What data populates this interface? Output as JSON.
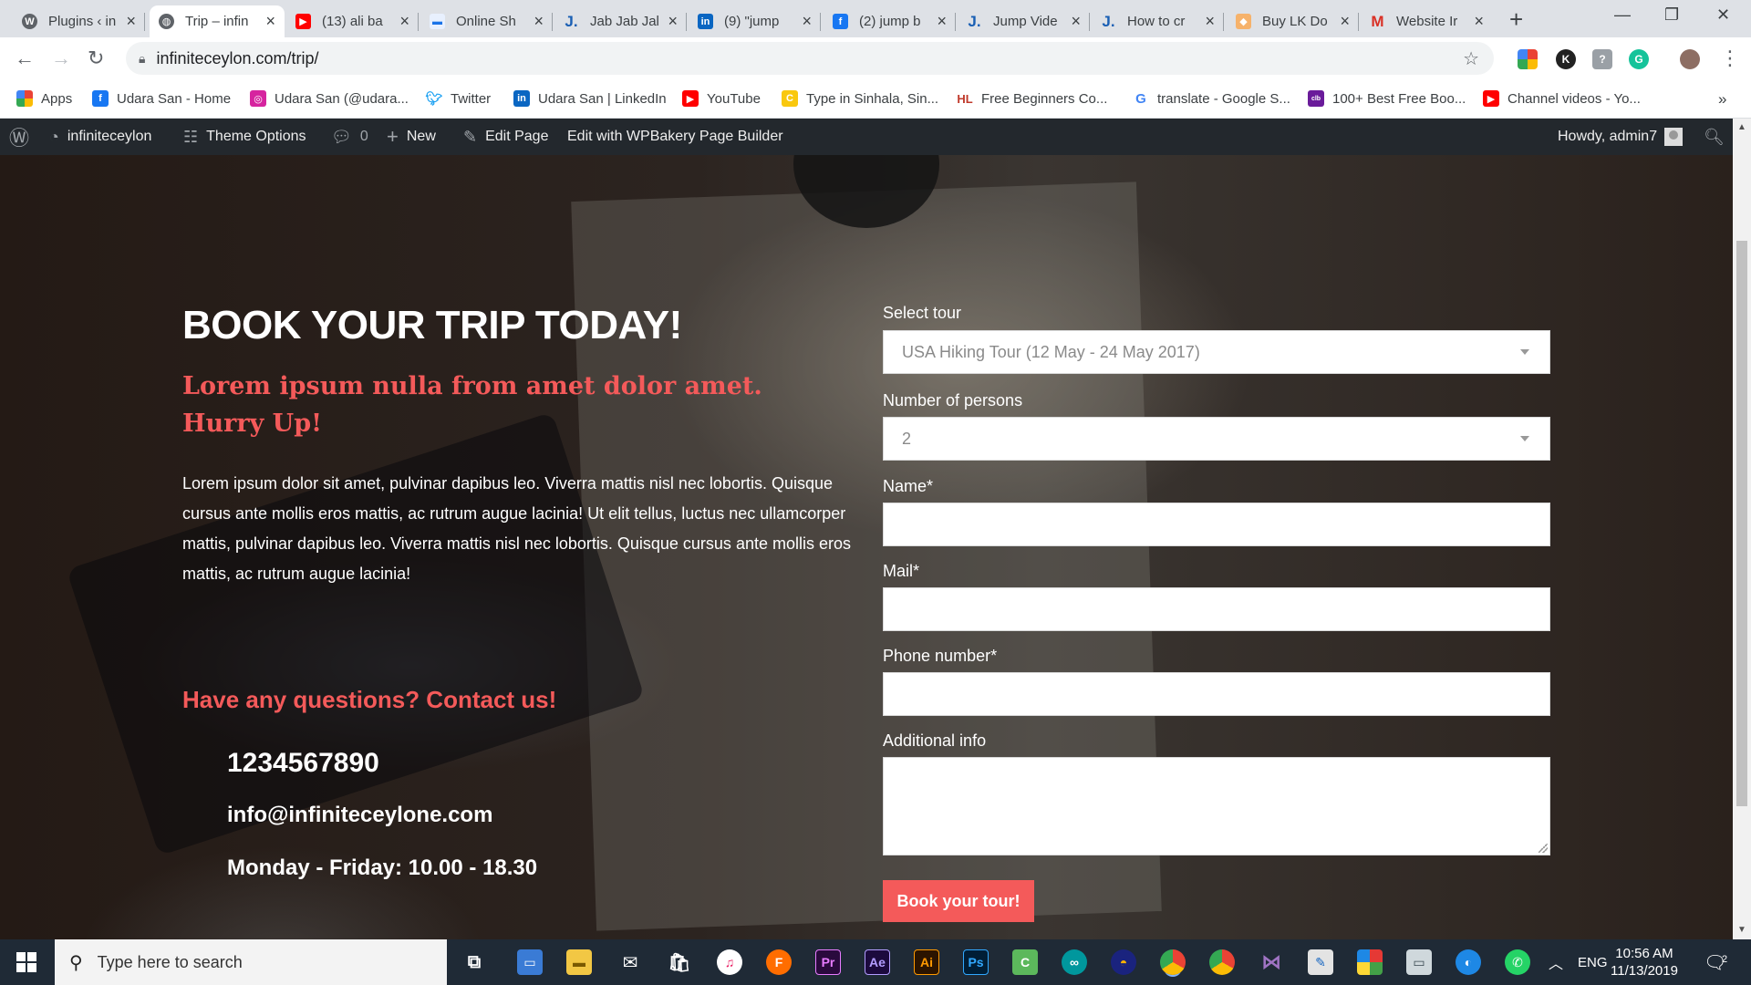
{
  "browser": {
    "tabs": [
      {
        "title": "Plugins ‹ in",
        "icon": "wordpress-icon",
        "active": false
      },
      {
        "title": "Trip – infin",
        "icon": "globe-icon",
        "active": true
      },
      {
        "title": "(13) ali ba",
        "icon": "youtube-icon",
        "active": false
      },
      {
        "title": "Online Sh",
        "icon": "shop-icon",
        "active": false
      },
      {
        "title": "Jab Jab Jal",
        "icon": "j-icon",
        "active": false
      },
      {
        "title": "(9) \"jump",
        "icon": "linkedin-icon",
        "active": false
      },
      {
        "title": "(2) jump b",
        "icon": "facebook-icon",
        "active": false
      },
      {
        "title": "Jump Vide",
        "icon": "j-icon",
        "active": false
      },
      {
        "title": "How to cr",
        "icon": "j-icon",
        "active": false
      },
      {
        "title": "Buy LK Do",
        "icon": "tag-icon",
        "active": false
      },
      {
        "title": "Website Ir",
        "icon": "gmail-icon",
        "active": false
      }
    ],
    "url": "infiniteceylon.com/trip/",
    "bookmarks": [
      {
        "label": "Apps",
        "icon": "apps-grid-icon"
      },
      {
        "label": "Udara San - Home",
        "icon": "facebook-icon"
      },
      {
        "label": "Udara San (@udara...",
        "icon": "instagram-icon"
      },
      {
        "label": "Twitter",
        "icon": "twitter-icon"
      },
      {
        "label": "Udara San | LinkedIn",
        "icon": "linkedin-icon"
      },
      {
        "label": "YouTube",
        "icon": "youtube-icon"
      },
      {
        "label": "Type in Sinhala, Sin...",
        "icon": "keyboard-icon"
      },
      {
        "label": "Free Beginners Co...",
        "icon": "hl-icon"
      },
      {
        "label": "translate - Google S...",
        "icon": "google-icon"
      },
      {
        "label": "100+ Best Free Boo...",
        "icon": "colorlib-icon"
      },
      {
        "label": "Channel videos - Yo...",
        "icon": "youtube-icon"
      }
    ],
    "more_bookmarks": "»"
  },
  "adminbar": {
    "site": "infiniteceylon",
    "theme_options": "Theme Options",
    "comments_count": "0",
    "new_label": "New",
    "edit_page": "Edit Page",
    "wpbakery": "Edit with WPBakery Page Builder",
    "howdy": "Howdy, admin7"
  },
  "hero": {
    "title": "BOOK YOUR TRIP TODAY!",
    "subtitle_line1": "Lorem ipsum nulla from amet dolor amet.",
    "subtitle_line2": "Hurry Up!",
    "paragraph": "Lorem ipsum dolor sit amet, pulvinar dapibus leo. Viverra mattis nisl nec lobortis. Quisque cursus ante mollis eros mattis, ac rutrum augue lacinia! Ut elit tellus, luctus nec ullamcorper mattis, pulvinar dapibus leo. Viverra mattis nisl nec lobortis. Quisque cursus ante mollis eros mattis, ac rutrum augue lacinia!",
    "contact_heading": "Have any questions? Contact us!",
    "phone": "1234567890",
    "email": "info@infiniteceylone.com",
    "hours": "Monday - Friday: 10.00 - 18.30"
  },
  "form": {
    "tour_label": "Select tour",
    "tour_value": "USA Hiking Tour (12 May - 24 May 2017)",
    "persons_label": "Number of persons",
    "persons_value": "2",
    "name_label": "Name*",
    "mail_label": "Mail*",
    "phone_label": "Phone number*",
    "info_label": "Additional info",
    "submit_label": "Book your tour!"
  },
  "taskbar": {
    "search_placeholder": "Type here to search",
    "language": "ENG",
    "time": "10:56 AM",
    "date": "11/13/2019",
    "notification_count": "2"
  },
  "colors": {
    "accent": "#f45a5a",
    "adminbar": "#23282d",
    "taskbar": "#1f2a36"
  }
}
